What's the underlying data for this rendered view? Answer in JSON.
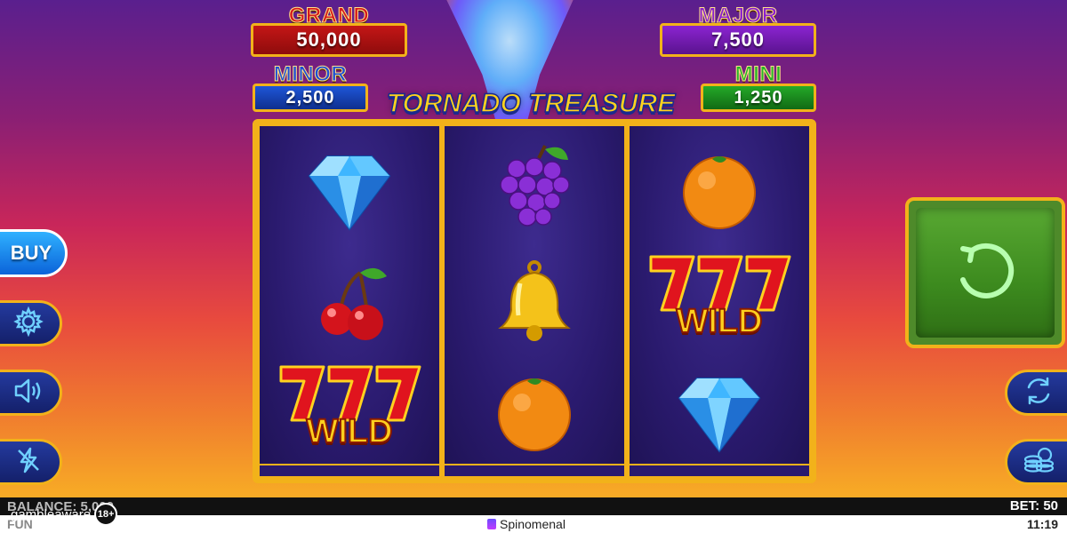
{
  "jackpots": {
    "grand": {
      "label": "GRAND",
      "value": "50,000"
    },
    "major": {
      "label": "MAJOR",
      "value": "7,500"
    },
    "minor": {
      "label": "MINOR",
      "value": "2,500"
    },
    "mini": {
      "label": "MINI",
      "value": "1,250"
    }
  },
  "game": {
    "title": "TORNADO TREASURE"
  },
  "reels": [
    [
      "diamond",
      "cherry",
      "wild-777"
    ],
    [
      "grapes",
      "bell",
      "orange"
    ],
    [
      "orange",
      "wild-777",
      "diamond"
    ]
  ],
  "wild_label": "WILD",
  "controls": {
    "buy_label": "BUY",
    "settings_icon": "gear-icon",
    "sound_icon": "speaker-icon",
    "turbo_icon": "lightning-off-icon",
    "autoplay_icon": "autoplay-icon",
    "bet_icon": "coins-icon",
    "spin_icon": "spin-icon"
  },
  "status": {
    "balance": "BALANCE: 5,000",
    "bet": "BET: 50"
  },
  "footer": {
    "mode": "FUN",
    "brand": "Spinomenal",
    "time": "11:19",
    "gambleaware": "gambleaware",
    "age": "18+"
  },
  "colors": {
    "gold": "#f2b21a",
    "grand": "#c41616",
    "major": "#8b24d1",
    "minor": "#1e56d8",
    "mini": "#24a928",
    "spin": "#4e8a2a"
  }
}
